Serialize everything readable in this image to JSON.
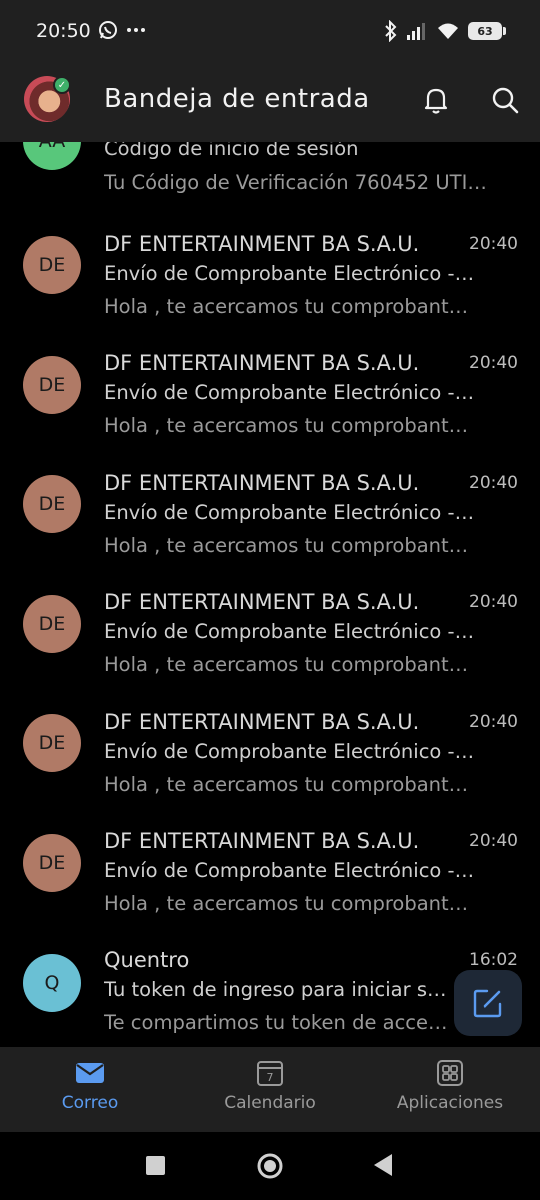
{
  "status_bar": {
    "time": "20:50",
    "notification_icons": [
      "whatsapp-icon",
      "more-dots-icon"
    ],
    "system_icons": [
      "bluetooth-icon",
      "signal-icon",
      "wifi-icon"
    ],
    "battery": "63"
  },
  "header": {
    "title": "Bandeja de entrada",
    "icons": [
      "bell-icon",
      "search-icon"
    ]
  },
  "colors": {
    "accent": "#5b9bf0",
    "avatar_de": "#b07a66",
    "avatar_aa": "#58c77b",
    "avatar_q": "#6ac0d4"
  },
  "emails": [
    {
      "initials": "AA",
      "sender": "",
      "time": "",
      "subject": "Código de inicio de sesión",
      "preview": "Tu Código de Verificación 760452 UTI…"
    },
    {
      "initials": "DE",
      "sender": "DF ENTERTAINMENT BA S.A.U.",
      "time": "20:40",
      "subject": "Envío de Comprobante Electrónico -…",
      "preview": "Hola , te acercamos tu comprobant…"
    },
    {
      "initials": "DE",
      "sender": "DF ENTERTAINMENT BA S.A.U.",
      "time": "20:40",
      "subject": "Envío de Comprobante Electrónico -…",
      "preview": "Hola , te acercamos tu comprobant…"
    },
    {
      "initials": "DE",
      "sender": "DF ENTERTAINMENT BA S.A.U.",
      "time": "20:40",
      "subject": "Envío de Comprobante Electrónico -…",
      "preview": "Hola , te acercamos tu comprobant…"
    },
    {
      "initials": "DE",
      "sender": "DF ENTERTAINMENT BA S.A.U.",
      "time": "20:40",
      "subject": "Envío de Comprobante Electrónico -…",
      "preview": "Hola , te acercamos tu comprobant…"
    },
    {
      "initials": "DE",
      "sender": "DF ENTERTAINMENT BA S.A.U.",
      "time": "20:40",
      "subject": "Envío de Comprobante Electrónico -…",
      "preview": "Hola , te acercamos tu comprobant…"
    },
    {
      "initials": "DE",
      "sender": "DF ENTERTAINMENT BA S.A.U.",
      "time": "20:40",
      "subject": "Envío de Comprobante Electrónico -…",
      "preview": "Hola , te acercamos tu comprobant…"
    },
    {
      "initials": "Q",
      "sender": "Quentro",
      "time": "16:02",
      "subject": "Tu token de ingreso para iniciar s…",
      "preview": "Te compartimos tu token de acce…"
    }
  ],
  "compose": {
    "icon": "compose-icon"
  },
  "bottom_nav": {
    "items": [
      {
        "label": "Correo",
        "icon": "mail-icon",
        "active": true
      },
      {
        "label": "Calendario",
        "icon": "calendar-icon",
        "calendar_day": "7",
        "active": false
      },
      {
        "label": "Aplicaciones",
        "icon": "apps-grid-icon",
        "active": false
      }
    ]
  },
  "system_nav": {
    "icons": [
      "recents-icon",
      "home-icon",
      "back-icon"
    ]
  }
}
